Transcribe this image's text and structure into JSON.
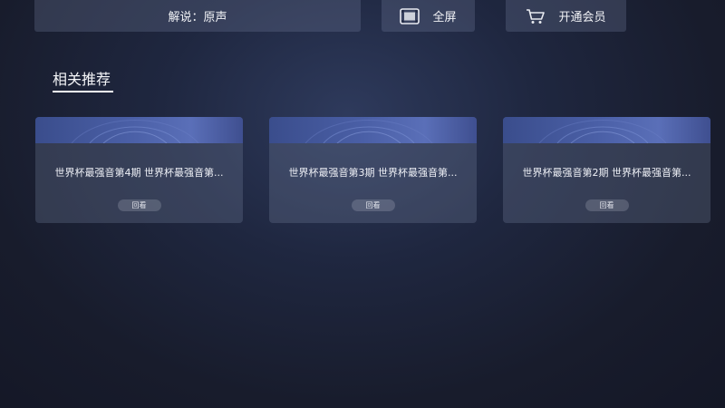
{
  "top_bar": {
    "commentary_label": "解说：原声",
    "fullscreen_label": "全屏",
    "vip_label": "开通会员"
  },
  "related": {
    "section_title": "相关推荐",
    "cards": [
      {
        "title": "世界杯最强音第4期 世界杯最强音第...",
        "tag": "回看"
      },
      {
        "title": "世界杯最强音第3期 世界杯最强音第...",
        "tag": "回看"
      },
      {
        "title": "世界杯最强音第2期 世界杯最强音第...",
        "tag": "回看"
      }
    ]
  },
  "icons": {
    "fullscreen": "fullscreen-icon",
    "vip": "shopping-cart-icon"
  }
}
